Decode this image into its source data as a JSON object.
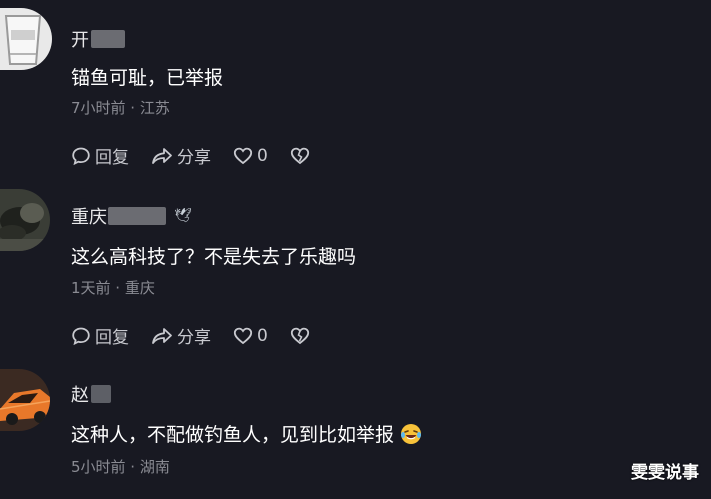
{
  "comments": [
    {
      "username_visible": "开",
      "content": "锚鱼可耻，已举报",
      "meta": "7小时前 · 江苏",
      "actions": {
        "reply": "回复",
        "share": "分享",
        "likes": "0"
      }
    },
    {
      "username_visible": "重庆",
      "badge": "🕊",
      "content": "这么高科技了？不是失去了乐趣吗",
      "meta": "1天前 · 重庆",
      "actions": {
        "reply": "回复",
        "share": "分享",
        "likes": "0"
      }
    },
    {
      "username_visible": "赵",
      "content": "这种人，不配做钓鱼人，见到比如举报",
      "meta": "5小时前 · 湖南"
    }
  ],
  "watermark": "雯雯说事",
  "icons": {
    "reply": "comment-bubble-icon",
    "share": "share-arrow-icon",
    "like": "heart-icon",
    "dislike": "broken-heart-icon",
    "emoji": "laughing-tears-emoji"
  }
}
